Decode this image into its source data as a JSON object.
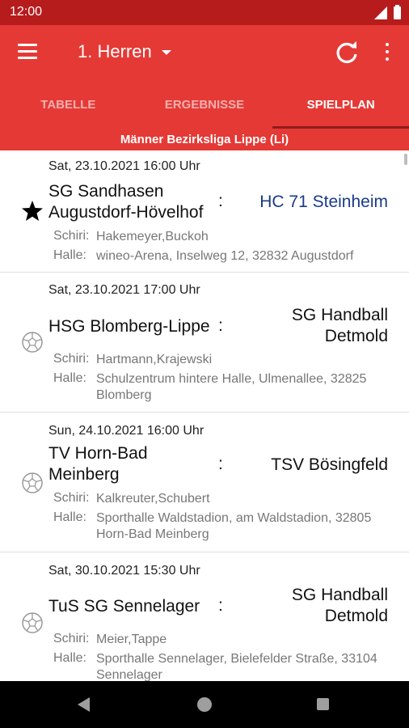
{
  "status_bar": {
    "time": "12:00",
    "icons": [
      "signal-icon",
      "battery-icon"
    ]
  },
  "app_bar": {
    "team": "1. Herren",
    "icons": [
      "menu-icon",
      "chevron-down-icon",
      "refresh-icon",
      "more-vert-icon"
    ]
  },
  "tabs": [
    {
      "label": "TABELLE",
      "active": false
    },
    {
      "label": "ERGEBNISSE",
      "active": false
    },
    {
      "label": "SPIELPLAN",
      "active": true
    }
  ],
  "league": "Männer Bezirksliga Lippe (Li)",
  "labels": {
    "referee": "Schiri:",
    "hall": "Halle:",
    "separator": ":"
  },
  "matches": [
    {
      "date": "Sat, 23.10.2021 16:00 Uhr",
      "home": "SG Sandhasen Augustdorf-Hövelhof",
      "away": "HC 71 Steinheim",
      "referee": "Hakemeyer,Buckoh",
      "hall": "wineo-Arena, Inselweg 12, 32832 Augustdorf",
      "icon": "star-icon",
      "favorite": true
    },
    {
      "date": "Sat, 23.10.2021 17:00 Uhr",
      "home": "HSG Blomberg-Lippe",
      "away": "SG Handball Detmold",
      "referee": "Hartmann,Krajewski",
      "hall": "Schulzentrum hintere Halle, Ulmenallee, 32825 Blomberg",
      "icon": "handball-icon",
      "favorite": false
    },
    {
      "date": "Sun, 24.10.2021 16:00 Uhr",
      "home": "TV Horn-Bad Meinberg",
      "away": "TSV Bösingfeld",
      "referee": "Kalkreuter,Schubert",
      "hall": "Sporthalle Waldstadion, am Waldstadion, 32805 Horn-Bad Meinberg",
      "icon": "handball-icon",
      "favorite": false
    },
    {
      "date": "Sat, 30.10.2021 15:30 Uhr",
      "home": "TuS SG Sennelager",
      "away": "SG Handball Detmold",
      "referee": "Meier,Tappe",
      "hall": "Sporthalle Sennelager, Bielefelder Straße, 33104 Sennelager",
      "icon": "handball-icon",
      "favorite": false
    }
  ],
  "colors": {
    "primary": "#e53935",
    "status_bar": "#b71c1c",
    "favorite_team": "#1a3a8a"
  }
}
